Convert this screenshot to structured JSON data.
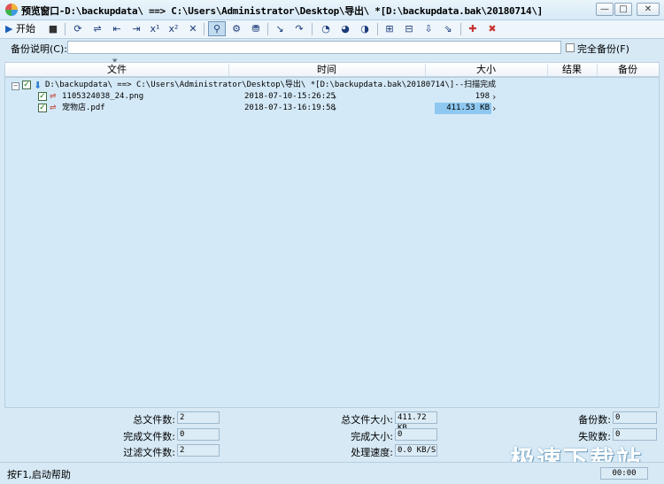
{
  "window": {
    "title": "预览窗口-D:\\backupdata\\ ==> C:\\Users\\Administrator\\Desktop\\导出\\ *[D:\\backupdata.bak\\20180714\\]",
    "minimize": "—",
    "maximize": "□",
    "close": "✕"
  },
  "toolbar": {
    "start_label": "开始",
    "start_icon": "▶",
    "stop_icon": "■",
    "buttons": [
      "⟳",
      "⇌",
      "⇤",
      "⇥",
      "x¹",
      "x²",
      "✕",
      "⚲",
      "⚙",
      "⛃",
      "↘",
      "↷",
      "◔",
      "◕",
      "◑",
      "⊞",
      "⊟",
      "⇩",
      "⇘",
      "✚",
      "✖"
    ]
  },
  "comment": {
    "label": "备份说明(C):",
    "value": "",
    "full_backup_label": "完全备份(F)"
  },
  "columns": [
    "文件",
    "时间",
    "大小",
    "结果",
    "备份"
  ],
  "tree": {
    "root": {
      "label": "D:\\backupdata\\ ==> C:\\Users\\Administrator\\Desktop\\导出\\ *[D:\\backupdata.bak\\20180714\\]--扫描完成",
      "checked": true
    },
    "files": [
      {
        "name": "1105324038_24.png",
        "time": "2018-07-10-15:26:25",
        "size": "198",
        "checked": true
      },
      {
        "name": "宠物店.pdf",
        "time": "2018-07-13-16:19:58",
        "size": "411.53 KB",
        "checked": true
      }
    ]
  },
  "stats": {
    "total_files_label": "总文件数:",
    "total_files": "2",
    "completed_files_label": "完成文件数:",
    "completed_files": "0",
    "filtered_files_label": "过滤文件数:",
    "filtered_files": "2",
    "total_size_label": "总文件大小:",
    "total_size": "411.72 KB",
    "completed_size_label": "完成大小:",
    "completed_size": "0",
    "speed_label": "处理速度:",
    "speed": "0.0 KB/S",
    "backup_count_label": "备份数:",
    "backup_count": "0",
    "fail_count_label": "失败数:",
    "fail_count": "0"
  },
  "status": {
    "help": "按F1,启动帮助",
    "time": "00:00"
  },
  "watermark": "极速下载站",
  "colors": {
    "list_bg": "#d4e9f7",
    "highlight": "#8ec8f0",
    "titlebar": "#d7eaf7"
  }
}
